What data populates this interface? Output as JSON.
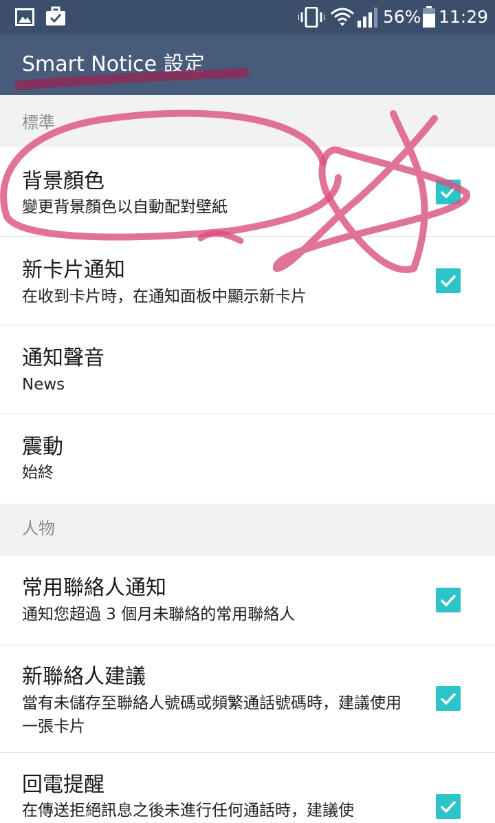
{
  "status_bar": {
    "battery_percent": "56%",
    "time": "11:29",
    "icons": [
      "image-icon",
      "briefcase-check-icon",
      "vibrate-icon",
      "wifi-icon",
      "cellular-signal-icon",
      "battery-icon"
    ]
  },
  "app_bar": {
    "title": "Smart Notice 設定"
  },
  "sections": [
    {
      "label": "標準",
      "items": [
        {
          "title": "背景顏色",
          "subtitle": "變更背景顏色以自動配對壁紙",
          "checked": true
        },
        {
          "title": "新卡片通知",
          "subtitle": "在收到卡片時，在通知面板中顯示新卡片",
          "checked": true
        },
        {
          "title": "通知聲音",
          "subtitle": "News"
        },
        {
          "title": "震動",
          "subtitle": "始終"
        }
      ]
    },
    {
      "label": "人物",
      "items": [
        {
          "title": "常用聯絡人通知",
          "subtitle": "通知您超過 3 個月未聯絡的常用聯絡人",
          "checked": true
        },
        {
          "title": "新聯絡人建議",
          "subtitle": "當有未儲存至聯絡人號碼或頻繁通話號碼時，建議使用一張卡片",
          "checked": true
        },
        {
          "title": "回電提醒",
          "subtitle": "在傳送拒絕訊息之後未進行任何通話時，建議使",
          "checked": true
        }
      ]
    }
  ],
  "colors": {
    "status_bar": "#3b4f6c",
    "app_bar": "#475c7a",
    "checkbox": "#2bc4c9",
    "section_bg": "#f2f2f2",
    "annotation_ink": "#d9507d"
  }
}
